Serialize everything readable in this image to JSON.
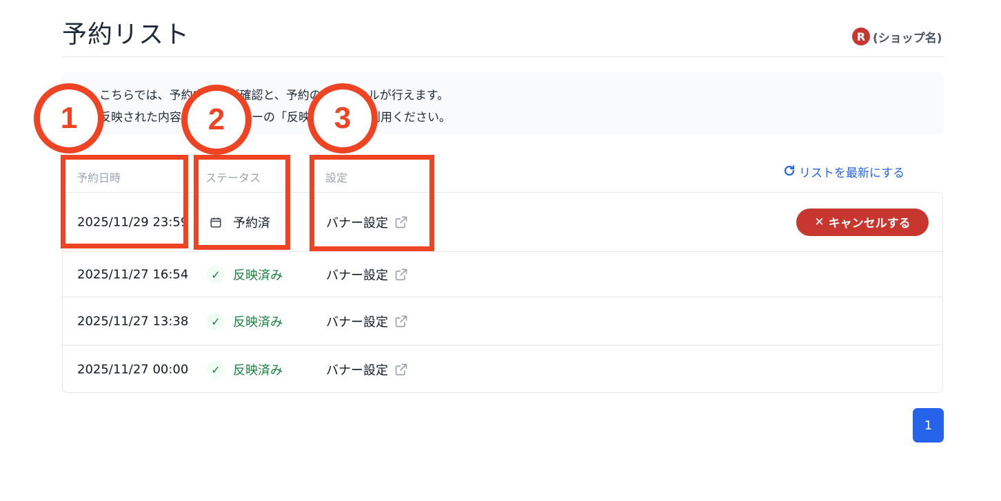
{
  "page": {
    "title": "予約リスト",
    "shop_logo_letter": "R",
    "shop_name": "(ショップ名)"
  },
  "info": {
    "line1": "こちらでは、予約内容のご確認と、予約のキャンセルが行えます。",
    "line2": "反映された内容は、左メニューの「反映履歴」をご利用ください。"
  },
  "table": {
    "headers": {
      "datetime": "予約日時",
      "status": "ステータス",
      "settings": "設定"
    },
    "refresh_label": "リストを最新にする",
    "rows": [
      {
        "datetime": "2025/11/29 23:59",
        "status": "予約済",
        "status_icon": "calendar-icon",
        "setting": "バナー設定",
        "action": "キャンセルする"
      },
      {
        "datetime": "2025/11/27 16:54",
        "status": "反映済み",
        "status_icon": "check-icon",
        "setting": "バナー設定"
      },
      {
        "datetime": "2025/11/27 13:38",
        "status": "反映済み",
        "status_icon": "check-icon",
        "setting": "バナー設定"
      },
      {
        "datetime": "2025/11/27 00:00",
        "status": "反映済み",
        "status_icon": "check-icon",
        "setting": "バナー設定"
      }
    ]
  },
  "pagination": {
    "current_page": "1"
  },
  "annotations": [
    "1",
    "2",
    "3"
  ],
  "colors": {
    "accent_blue": "#2563eb",
    "cancel_red": "#c7362f",
    "success_green": "#15803d",
    "annotation_red": "#ef4423"
  }
}
